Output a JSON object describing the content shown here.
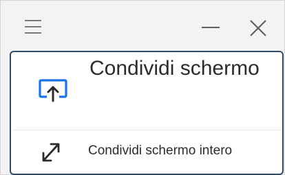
{
  "titlebar": {
    "menu_icon": "hamburger-menu-icon",
    "minimize_icon": "minimize-icon",
    "close_icon": "close-icon"
  },
  "menu": {
    "items": [
      {
        "label": "Condividi schermo",
        "icon": "screen-share-icon"
      },
      {
        "label": "Condividi schermo intero",
        "icon": "expand-diagonal-icon"
      }
    ]
  },
  "colors": {
    "accent": "#1a73e8",
    "panel_border": "#2e4a68",
    "text": "#2b2b2b",
    "window_bg": "#f3f3f3"
  }
}
